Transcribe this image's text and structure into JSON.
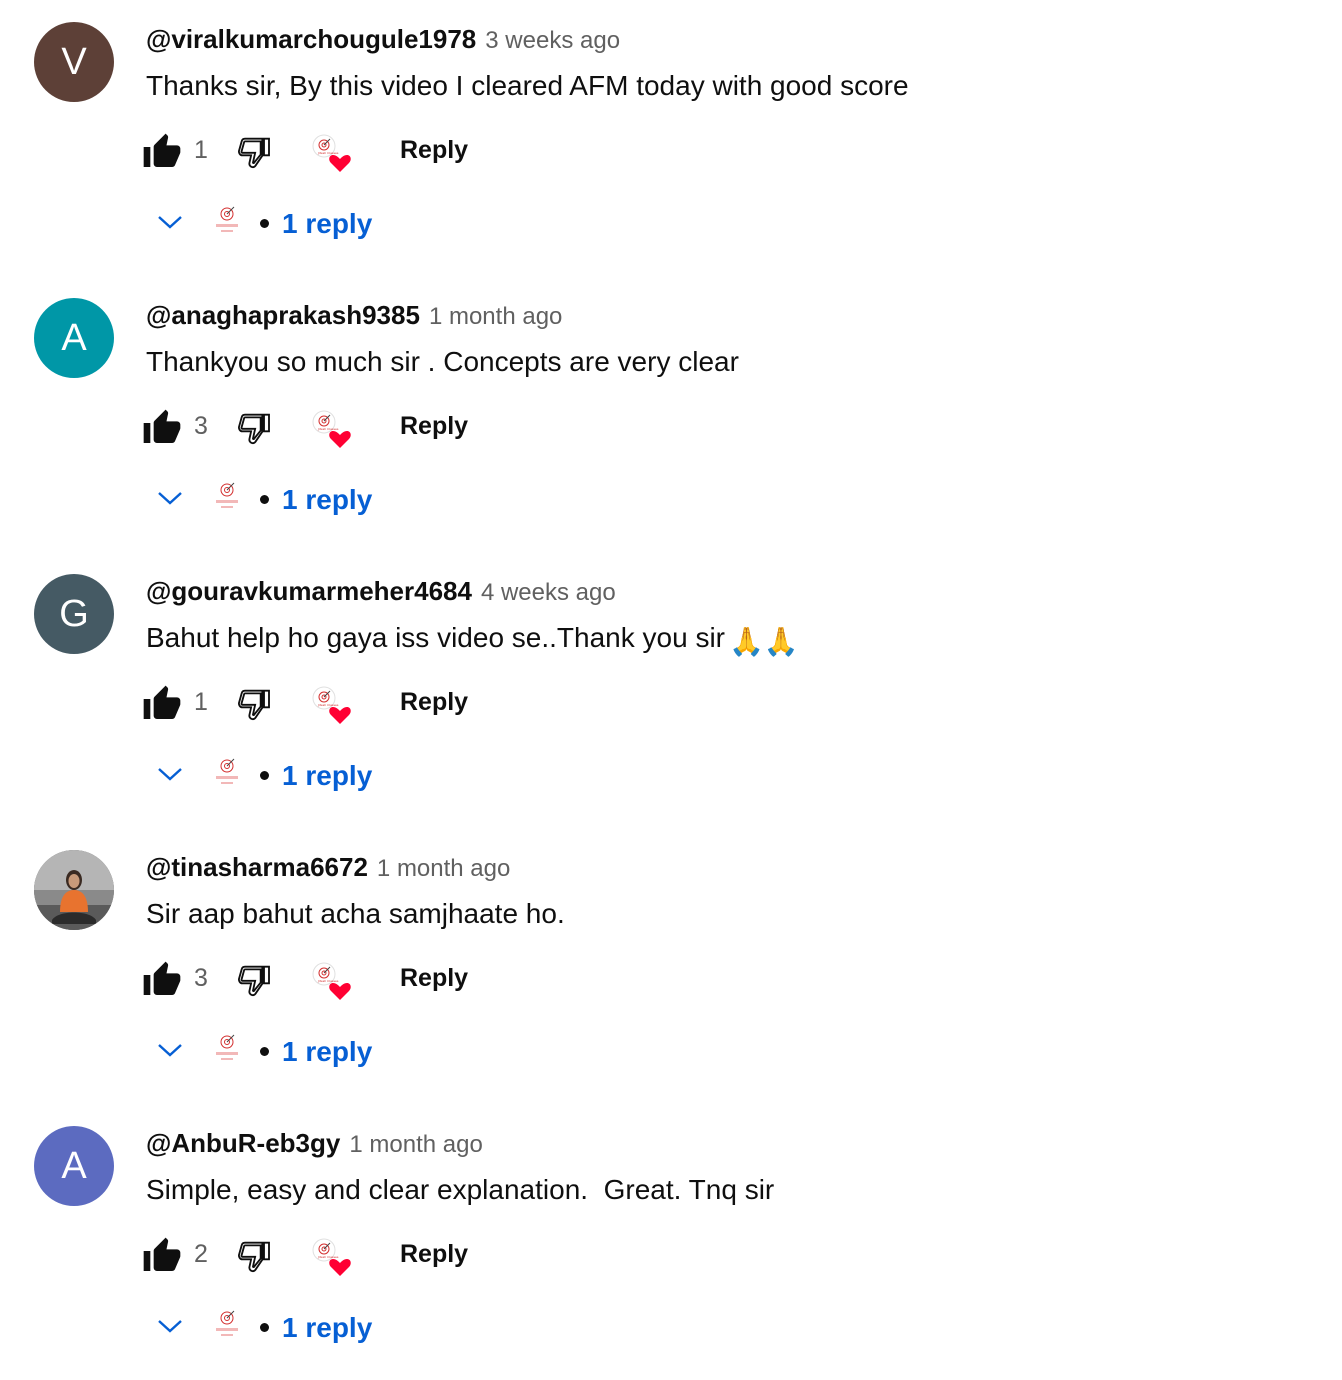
{
  "comments": [
    {
      "author": "@viralkumarchougule1978",
      "time": "3 weeks ago",
      "text": "Thanks sir, By this video I cleared AFM today with good score",
      "emoji": "",
      "avatar_letter": "V",
      "avatar_color": "#5d4037",
      "likes": "1",
      "reply_label": "Reply",
      "replies_label": "1 reply"
    },
    {
      "author": "@anaghaprakash9385",
      "time": "1 month ago",
      "text": "Thankyou so much sir . Concepts are very clear",
      "emoji": "",
      "avatar_letter": "A",
      "avatar_color": "#0097a7",
      "likes": "3",
      "reply_label": "Reply",
      "replies_label": "1 reply"
    },
    {
      "author": "@gouravkumarmeher4684",
      "time": "4 weeks ago",
      "text": "Bahut help ho gaya iss video se..Thank you sir",
      "emoji": "🙏🙏",
      "avatar_letter": "G",
      "avatar_color": "#455a64",
      "likes": "1",
      "reply_label": "Reply",
      "replies_label": "1 reply"
    },
    {
      "author": "@tinasharma6672",
      "time": "1 month ago",
      "text": "Sir aap bahut acha samjhaate ho.",
      "emoji": "",
      "avatar_letter": "",
      "avatar_color": "#6d6d6d",
      "likes": "3",
      "reply_label": "Reply",
      "replies_label": "1 reply"
    },
    {
      "author": "@AnbuR-eb3gy",
      "time": "1 month ago",
      "text": "Simple, easy and clear explanation.  Great. Tnq sir",
      "emoji": "",
      "avatar_letter": "A",
      "avatar_color": "#5c6bc0",
      "likes": "2",
      "reply_label": "Reply",
      "replies_label": "1 reply"
    }
  ],
  "colors": {
    "link_blue": "#065fd4",
    "secondary_text": "#606060",
    "heart_red": "#ff0033"
  },
  "icons": [
    "thumbs-up-icon",
    "thumbs-down-icon",
    "creator-heart-icon",
    "chevron-down-icon",
    "channel-avatar-icon"
  ]
}
